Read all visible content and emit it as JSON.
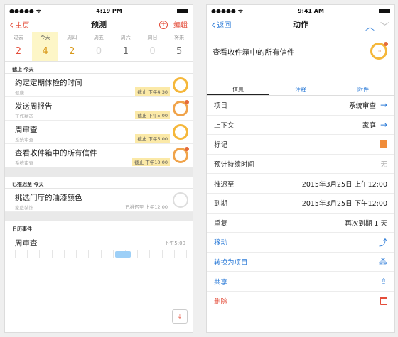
{
  "left": {
    "status": {
      "carrier": "●●●●● ᯤ",
      "time": "4:19 PM"
    },
    "nav": {
      "back": "主页",
      "title": "预测",
      "edit": "编辑"
    },
    "days": [
      {
        "name": "过去",
        "count": "2",
        "color": "#e44d3a",
        "selected": false
      },
      {
        "name": "今天",
        "count": "4",
        "color": "#d99a1c",
        "selected": true
      },
      {
        "name": "周四",
        "count": "2",
        "color": "#d99a1c",
        "selected": false
      },
      {
        "name": "周五",
        "count": "0",
        "color": "#d4d4d4",
        "selected": false
      },
      {
        "name": "周六",
        "count": "1",
        "color": "#666666",
        "selected": false
      },
      {
        "name": "周日",
        "count": "0",
        "color": "#d4d4d4",
        "selected": false
      },
      {
        "name": "将来",
        "count": "5",
        "color": "#666666",
        "selected": false
      }
    ],
    "sections": {
      "due_today": "截止 今天",
      "deferred_today": "已推迟至 今天",
      "calendar": "日历事件"
    },
    "tasks_due": [
      {
        "title": "约定定期体检的时间",
        "context": "健康",
        "due": "截止 下午4:30"
      },
      {
        "title": "发送周报告",
        "context": "工作状态",
        "due": "截止 下午5:00"
      },
      {
        "title": "周审查",
        "context": "系统审查",
        "due": "截止 下午5:00"
      },
      {
        "title": "查看收件箱中的所有信件",
        "context": "系统审查",
        "due": "截止 下午10:00"
      }
    ],
    "tasks_deferred": [
      {
        "title": "挑选门厅的油漆颜色",
        "context": "家庭装饰",
        "due": "已推迟至 上午12:00"
      }
    ],
    "calendar_event": {
      "title": "周审查",
      "time": "下午5:00"
    }
  },
  "right": {
    "status": {
      "carrier": "●●●●● ᯤ",
      "time": "9:41 AM"
    },
    "nav": {
      "back": "返回",
      "title": "动作"
    },
    "task_title": "查看收件箱中的所有信件",
    "tabs": [
      "信息",
      "注释",
      "附件"
    ],
    "fields": [
      {
        "label": "项目",
        "value": "系统审查",
        "icon": "→"
      },
      {
        "label": "上下文",
        "value": "家庭",
        "icon": "→"
      },
      {
        "label": "标记",
        "value": "",
        "icon": "flag"
      },
      {
        "label": "预计持续时间",
        "value": "无",
        "icon": ""
      },
      {
        "label": "推迟至",
        "value": "2015年3月25日   上午12:00",
        "icon": ""
      },
      {
        "label": "到期",
        "value": "2015年3月25日   下午12:00",
        "icon": ""
      },
      {
        "label": "重复",
        "value": "再次到期 1 天",
        "icon": ""
      }
    ],
    "actions": {
      "move": "移动",
      "convert": "转换为项目",
      "share": "共享",
      "delete": "删除"
    }
  },
  "colors": {
    "accent_blue": "#2f7dd8",
    "accent_red": "#e44d3a",
    "due_highlight": "#fbe9a7",
    "today_highlight": "#fdf6c7"
  }
}
